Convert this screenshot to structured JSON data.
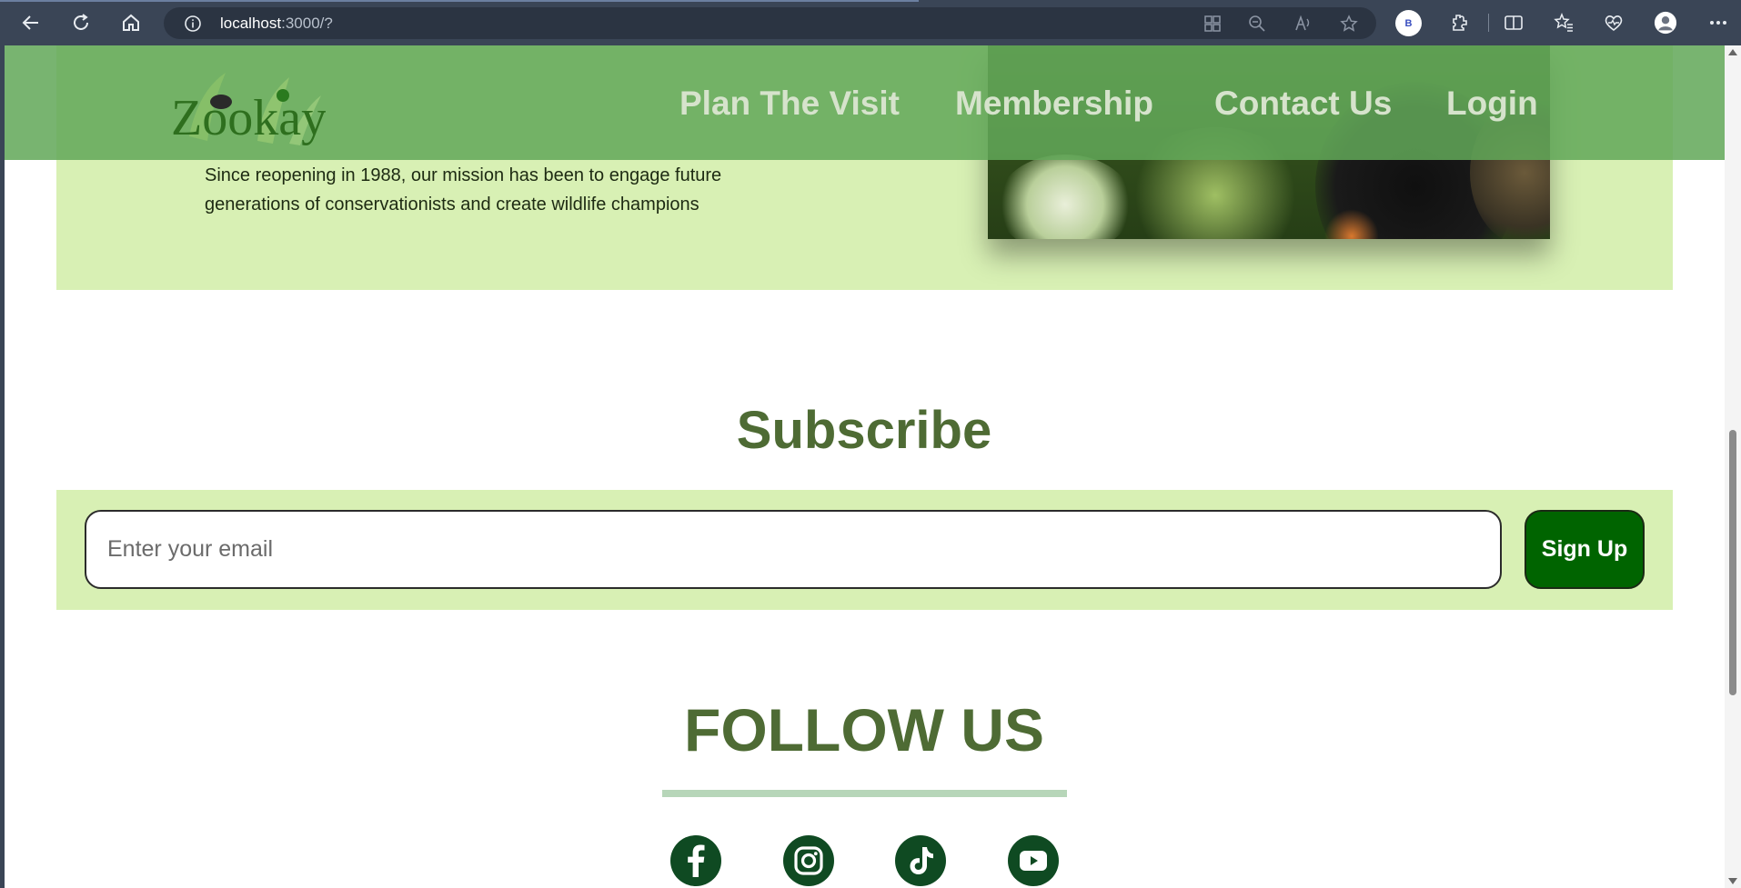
{
  "browser": {
    "url_host": "localhost",
    "url_rest": ":3000/?",
    "profile_initial": "B"
  },
  "nav": {
    "logo_text": "Zookay",
    "links": [
      "Plan The Visit",
      "Membership",
      "Contact Us",
      "Login"
    ]
  },
  "about": {
    "text": "Since reopening in 1988, our mission has been to engage future generations of conservationists and create wildlife champions"
  },
  "subscribe": {
    "title": "Subscribe",
    "email_placeholder": "Enter your email",
    "button_label": "Sign Up"
  },
  "follow": {
    "title": "FOLLOW US",
    "icons": [
      "facebook-icon",
      "instagram-icon",
      "tiktok-icon",
      "youtube-icon"
    ]
  },
  "colors": {
    "header_green": "#62a858",
    "band_green": "#d8f0b4",
    "title_green": "#4e6b34",
    "button_green": "#006400",
    "social_green": "#0f4a22"
  }
}
